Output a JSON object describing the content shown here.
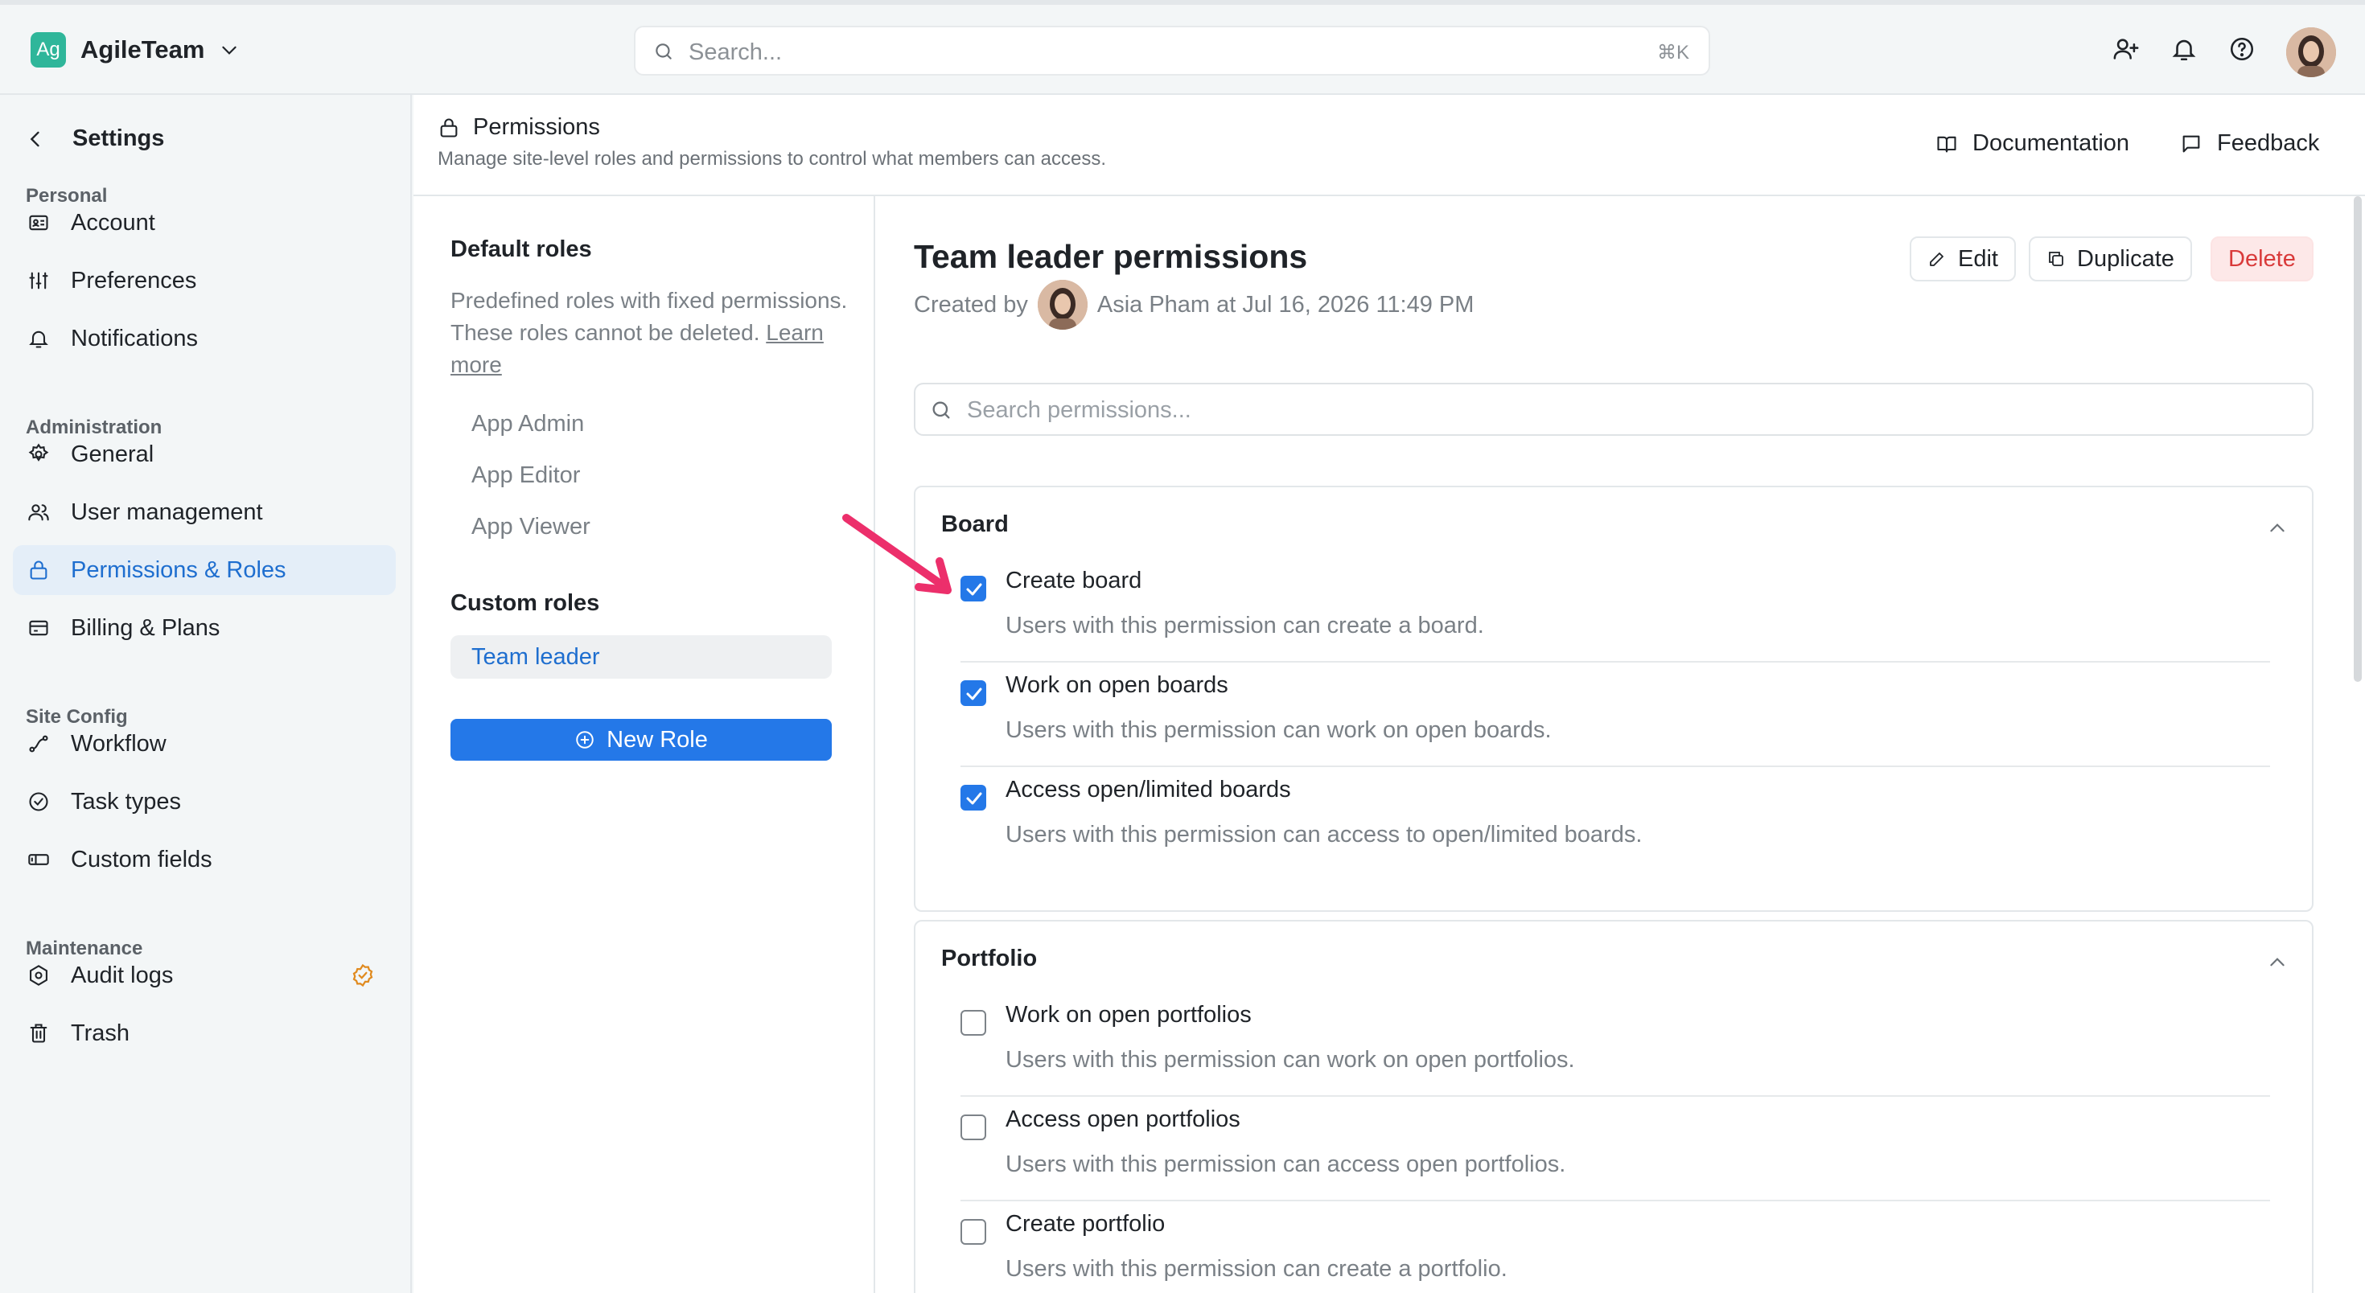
{
  "workspace": {
    "logo": "Ag",
    "name": "AgileTeam"
  },
  "search": {
    "placeholder": "Search...",
    "shortcut": "⌘K"
  },
  "topbar_icons": [
    "add-user-icon",
    "bell-icon",
    "help-icon"
  ],
  "sidebar": {
    "title": "Settings",
    "sections": [
      {
        "label": "Personal",
        "items": [
          {
            "label": "Account",
            "icon": "id-card-icon"
          },
          {
            "label": "Preferences",
            "icon": "sliders-icon"
          },
          {
            "label": "Notifications",
            "icon": "bell-icon"
          }
        ]
      },
      {
        "label": "Administration",
        "items": [
          {
            "label": "General",
            "icon": "gear-icon"
          },
          {
            "label": "User management",
            "icon": "users-icon"
          },
          {
            "label": "Permissions & Roles",
            "icon": "lock-icon",
            "active": true
          },
          {
            "label": "Billing & Plans",
            "icon": "credit-card-icon"
          }
        ]
      },
      {
        "label": "Site Config",
        "items": [
          {
            "label": "Workflow",
            "icon": "workflow-icon"
          },
          {
            "label": "Task types",
            "icon": "check-circle-icon"
          },
          {
            "label": "Custom fields",
            "icon": "fields-icon"
          }
        ]
      },
      {
        "label": "Maintenance",
        "items": [
          {
            "label": "Audit logs",
            "icon": "audit-gear-icon"
          },
          {
            "label": "Trash",
            "icon": "trash-icon"
          }
        ]
      }
    ]
  },
  "header": {
    "title": "Permissions",
    "subtitle": "Manage site-level roles and permissions to control what members can access.",
    "documentation": "Documentation",
    "feedback": "Feedback"
  },
  "roles": {
    "default_title": "Default roles",
    "default_desc": "Predefined roles with fixed permissions. These roles cannot be deleted.",
    "learn_more": "Learn more",
    "default_items": [
      "App Admin",
      "App Editor",
      "App Viewer"
    ],
    "custom_title": "Custom roles",
    "custom_items": [
      "Team leader"
    ],
    "new_role": "New Role"
  },
  "detail": {
    "title": "Team leader permissions",
    "created_by_label": "Created by",
    "created_by_name": "Asia Pham at Jul 16, 2026 11:49 PM",
    "edit": "Edit",
    "duplicate": "Duplicate",
    "delete": "Delete",
    "search_placeholder": "Search permissions..."
  },
  "groups": [
    {
      "title": "Board",
      "expanded": true,
      "permissions": [
        {
          "name": "Create board",
          "desc": "Users with this permission can create a board.",
          "checked": true
        },
        {
          "name": "Work on open boards",
          "desc": "Users with this permission can work on open boards.",
          "checked": true
        },
        {
          "name": "Access open/limited boards",
          "desc": "Users with this permission can access to open/limited boards.",
          "checked": true
        }
      ]
    },
    {
      "title": "Portfolio",
      "expanded": true,
      "permissions": [
        {
          "name": "Work on open portfolios",
          "desc": "Users with this permission can work on open portfolios.",
          "checked": false
        },
        {
          "name": "Access open portfolios",
          "desc": "Users with this permission can access open portfolios.",
          "checked": false
        },
        {
          "name": "Create portfolio",
          "desc": "Users with this permission can create a portfolio.",
          "checked": false
        }
      ]
    }
  ],
  "colors": {
    "accent": "#2478e8",
    "active_nav_bg": "#e4eef8",
    "danger": "#d93a3a",
    "annotation_arrow": "#ec2f6b",
    "logo_bg": "#2fb69a"
  }
}
